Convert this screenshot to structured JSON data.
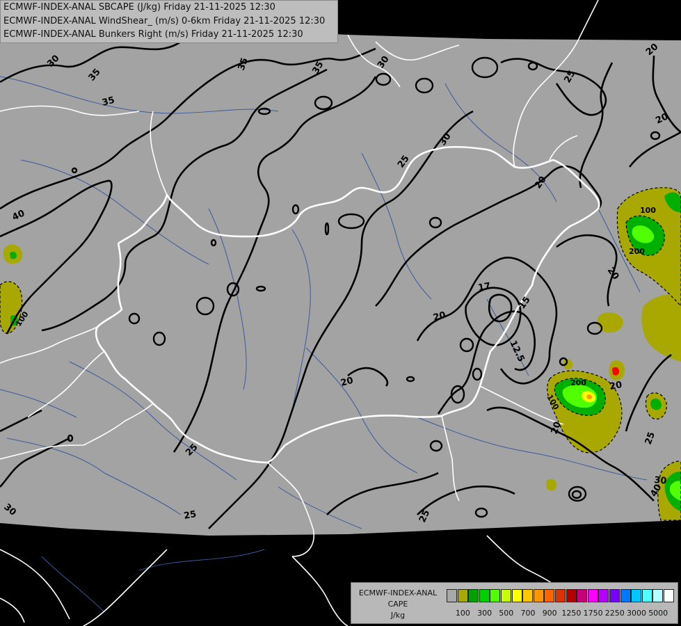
{
  "header": {
    "line1": "ECMWF-INDEX-ANAL SBCAPE (J/kg) Friday 21-11-2025 12:30",
    "line2": "ECMWF-INDEX-ANAL WindShear_ (m/s) 0-6km Friday 21-11-2025 12:30",
    "line3": "ECMWF-INDEX-ANAL Bunkers Right (m/s) Friday 21-11-2025 12:30"
  },
  "legend": {
    "title_line1": "ECMWF-INDEX-ANAL",
    "title_line2": "CAPE",
    "title_line3": "J/kg",
    "swatches": [
      "#a8a8a8",
      "#a8a800",
      "#00a000",
      "#00d000",
      "#50ff00",
      "#c8ff00",
      "#ffff00",
      "#ffc800",
      "#ff9600",
      "#ff6400",
      "#dc3200",
      "#b40000",
      "#c80078",
      "#ff00ff",
      "#b400ff",
      "#7800ff",
      "#0078ff",
      "#00c8ff",
      "#50ffff",
      "#b4ffff",
      "#ffffff"
    ],
    "tick_labels": [
      "100",
      "300",
      "500",
      "700",
      "900",
      "1250",
      "1750",
      "2250",
      "3000",
      "5000"
    ]
  },
  "map": {
    "colors": {
      "background": "#000000",
      "land_shade": "#a3a3a3",
      "contour": "#000000",
      "border": "#ffffff",
      "river": "#3a5a9a",
      "cape_100": "#a8a800",
      "cape_200": "#00b000",
      "cape_300": "#50ff00",
      "cape_500": "#ffff00",
      "cape_700": "#ff9600"
    },
    "contour_labels": [
      "30",
      "35",
      "35",
      "35",
      "35",
      "30",
      "30",
      "30",
      "25",
      "20",
      "20",
      "20",
      "40",
      "40",
      "100",
      "100",
      "200",
      "20",
      "25",
      "17",
      "15",
      "12.5",
      "20",
      "20",
      "200",
      "100",
      "20",
      "20",
      "25",
      "25",
      "25",
      "25",
      "30",
      "30",
      "20",
      "25",
      "25",
      "20"
    ]
  }
}
